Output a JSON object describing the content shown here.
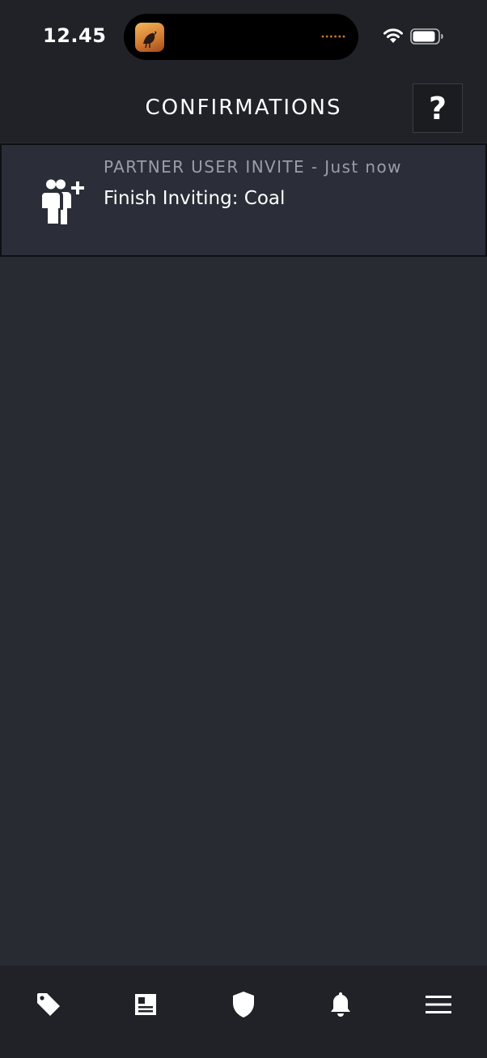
{
  "status_bar": {
    "time": "12.45",
    "island_app_icon": "bird-app-icon"
  },
  "header": {
    "title": "CONFIRMATIONS",
    "help_label": "?"
  },
  "confirmations": [
    {
      "icon": "add-user-icon",
      "type_label": "PARTNER USER INVITE - Just now",
      "title": "Finish Inviting: Coal"
    }
  ],
  "bottom_nav": {
    "items": [
      "tag-icon",
      "news-icon",
      "shield-icon",
      "bell-icon",
      "menu-icon"
    ]
  },
  "colors": {
    "background": "#292b33",
    "header_bg": "#202227",
    "row_bg": "#2b2e38",
    "muted_text": "#9a9ea8"
  }
}
